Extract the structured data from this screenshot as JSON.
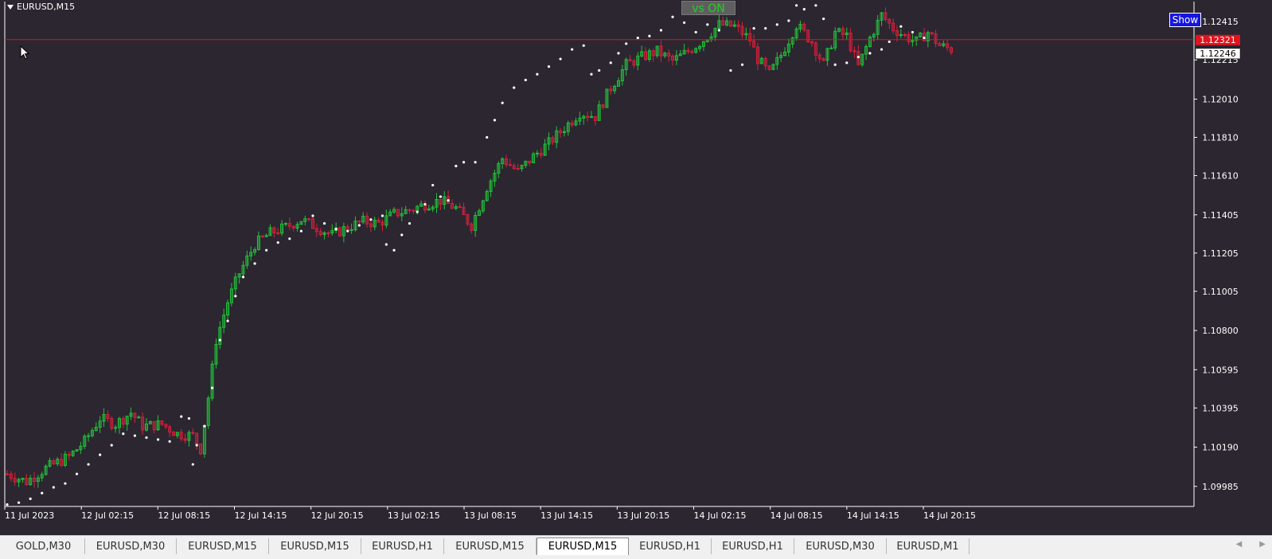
{
  "window": {
    "symbol": "EURUSD,M15"
  },
  "overlay": {
    "vs_label": "vs ON",
    "show_label": "Show"
  },
  "colors": {
    "background": "#2b2630",
    "bull": "#22c23a",
    "bear": "#d8203c",
    "dots": "#ffffff",
    "axis": "#ffffff",
    "hline": "#e0141e",
    "price_tag_red": "#e0141e"
  },
  "tabs": [
    {
      "label": "GOLD,M30",
      "active": false
    },
    {
      "label": "EURUSD,M30",
      "active": false
    },
    {
      "label": "EURUSD,M15",
      "active": false
    },
    {
      "label": "EURUSD,M15",
      "active": false
    },
    {
      "label": "EURUSD,H1",
      "active": false
    },
    {
      "label": "EURUSD,M15",
      "active": false
    },
    {
      "label": "EURUSD,M15",
      "active": true
    },
    {
      "label": "EURUSD,H1",
      "active": false
    },
    {
      "label": "EURUSD,H1",
      "active": false
    },
    {
      "label": "EURUSD,M30",
      "active": false
    },
    {
      "label": "EURUSD,M1",
      "active": false
    }
  ],
  "chart_data": {
    "type": "candlestick",
    "symbol": "EURUSD",
    "timeframe": "M15",
    "ylim": [
      1.0988,
      1.1252
    ],
    "y_ticks": [
      "1.12415",
      "1.12215",
      "1.12010",
      "1.11810",
      "1.11610",
      "1.11405",
      "1.11205",
      "1.11005",
      "1.10800",
      "1.10595",
      "1.10395",
      "1.10190",
      "1.09985"
    ],
    "x_ticks": [
      "11 Jul 2023",
      "12 Jul 02:15",
      "12 Jul 08:15",
      "12 Jul 14:15",
      "12 Jul 20:15",
      "13 Jul 02:15",
      "13 Jul 08:15",
      "13 Jul 14:15",
      "13 Jul 20:15",
      "14 Jul 02:15",
      "14 Jul 08:15",
      "14 Jul 14:15",
      "14 Jul 20:15"
    ],
    "current_price": "1.12321",
    "second_price": "1.12246",
    "close_path": [
      [
        0,
        1.1005
      ],
      [
        5,
        1.1001
      ],
      [
        10,
        1.1008
      ],
      [
        16,
        1.1014
      ],
      [
        20,
        1.1022
      ],
      [
        24,
        1.1034
      ],
      [
        28,
        1.1031
      ],
      [
        32,
        1.1037
      ],
      [
        35,
        1.103
      ],
      [
        40,
        1.1031
      ],
      [
        44,
        1.1026
      ],
      [
        48,
        1.1025
      ],
      [
        50,
        1.1018
      ],
      [
        52,
        1.1045
      ],
      [
        54,
        1.1075
      ],
      [
        57,
        1.1095
      ],
      [
        60,
        1.111
      ],
      [
        64,
        1.1125
      ],
      [
        68,
        1.1131
      ],
      [
        72,
        1.1134
      ],
      [
        76,
        1.1138
      ],
      [
        80,
        1.1134
      ],
      [
        84,
        1.113
      ],
      [
        88,
        1.1134
      ],
      [
        92,
        1.1137
      ],
      [
        96,
        1.1136
      ],
      [
        100,
        1.1141
      ],
      [
        104,
        1.1143
      ],
      [
        108,
        1.1146
      ],
      [
        112,
        1.1148
      ],
      [
        116,
        1.1144
      ],
      [
        120,
        1.1135
      ],
      [
        124,
        1.1155
      ],
      [
        128,
        1.117
      ],
      [
        132,
        1.1163
      ],
      [
        136,
        1.1171
      ],
      [
        140,
        1.1178
      ],
      [
        144,
        1.1186
      ],
      [
        148,
        1.1194
      ],
      [
        152,
        1.1192
      ],
      [
        156,
        1.1207
      ],
      [
        160,
        1.1219
      ],
      [
        164,
        1.1223
      ],
      [
        168,
        1.1226
      ],
      [
        172,
        1.1221
      ],
      [
        176,
        1.1226
      ],
      [
        180,
        1.1232
      ],
      [
        184,
        1.124
      ],
      [
        188,
        1.1239
      ],
      [
        192,
        1.1232
      ],
      [
        194,
        1.1222
      ],
      [
        197,
        1.1214
      ],
      [
        200,
        1.1224
      ],
      [
        204,
        1.124
      ],
      [
        208,
        1.1231
      ],
      [
        211,
        1.1219
      ],
      [
        214,
        1.1236
      ],
      [
        217,
        1.1234
      ],
      [
        220,
        1.1218
      ],
      [
        223,
        1.1233
      ],
      [
        226,
        1.1245
      ],
      [
        229,
        1.1238
      ],
      [
        232,
        1.1234
      ],
      [
        235,
        1.1231
      ],
      [
        238,
        1.1236
      ],
      [
        241,
        1.1229
      ],
      [
        244,
        1.1227
      ]
    ],
    "sar_points": [
      [
        0,
        1.0989
      ],
      [
        3,
        1.099
      ],
      [
        6,
        1.0992
      ],
      [
        9,
        1.0995
      ],
      [
        12,
        1.0998
      ],
      [
        15,
        1.1
      ],
      [
        18,
        1.1005
      ],
      [
        21,
        1.101
      ],
      [
        24,
        1.1015
      ],
      [
        27,
        1.102
      ],
      [
        30,
        1.1026
      ],
      [
        33,
        1.1025
      ],
      [
        36,
        1.1024
      ],
      [
        39,
        1.1023
      ],
      [
        42,
        1.1022
      ],
      [
        45,
        1.1035
      ],
      [
        47,
        1.1034
      ],
      [
        48,
        1.101
      ],
      [
        49,
        1.102
      ],
      [
        51,
        1.103
      ],
      [
        53,
        1.105
      ],
      [
        55,
        1.1075
      ],
      [
        57,
        1.1085
      ],
      [
        59,
        1.1098
      ],
      [
        61,
        1.1108
      ],
      [
        64,
        1.1115
      ],
      [
        67,
        1.1122
      ],
      [
        70,
        1.1126
      ],
      [
        73,
        1.1128
      ],
      [
        76,
        1.1132
      ],
      [
        79,
        1.114
      ],
      [
        82,
        1.1136
      ],
      [
        85,
        1.1133
      ],
      [
        88,
        1.1132
      ],
      [
        91,
        1.1135
      ],
      [
        94,
        1.1138
      ],
      [
        97,
        1.114
      ],
      [
        98,
        1.1125
      ],
      [
        100,
        1.1122
      ],
      [
        102,
        1.113
      ],
      [
        104,
        1.1136
      ],
      [
        106,
        1.1142
      ],
      [
        108,
        1.1146
      ],
      [
        110,
        1.1156
      ],
      [
        112,
        1.115
      ],
      [
        114,
        1.1148
      ],
      [
        116,
        1.1166
      ],
      [
        118,
        1.1168
      ],
      [
        121,
        1.1168
      ],
      [
        124,
        1.1181
      ],
      [
        126,
        1.119
      ],
      [
        128,
        1.1199
      ],
      [
        131,
        1.1207
      ],
      [
        134,
        1.1211
      ],
      [
        137,
        1.1214
      ],
      [
        140,
        1.1218
      ],
      [
        143,
        1.1222
      ],
      [
        146,
        1.1227
      ],
      [
        149,
        1.1229
      ],
      [
        151,
        1.1214
      ],
      [
        153,
        1.1216
      ],
      [
        156,
        1.122
      ],
      [
        158,
        1.1225
      ],
      [
        160,
        1.123
      ],
      [
        163,
        1.1233
      ],
      [
        166,
        1.1234
      ],
      [
        169,
        1.1237
      ],
      [
        172,
        1.1244
      ],
      [
        175,
        1.1241
      ],
      [
        178,
        1.1236
      ],
      [
        181,
        1.124
      ],
      [
        184,
        1.1237
      ],
      [
        187,
        1.1216
      ],
      [
        190,
        1.1219
      ],
      [
        193,
        1.1238
      ],
      [
        196,
        1.1238
      ],
      [
        199,
        1.124
      ],
      [
        202,
        1.1242
      ],
      [
        204,
        1.125
      ],
      [
        206,
        1.1248
      ],
      [
        207,
        1.1255
      ],
      [
        209,
        1.125
      ],
      [
        211,
        1.1243
      ],
      [
        214,
        1.1219
      ],
      [
        217,
        1.122
      ],
      [
        220,
        1.1223
      ],
      [
        223,
        1.1225
      ],
      [
        226,
        1.1227
      ],
      [
        228,
        1.1231
      ],
      [
        231,
        1.1239
      ],
      [
        234,
        1.1236
      ],
      [
        237,
        1.1233
      ]
    ]
  }
}
